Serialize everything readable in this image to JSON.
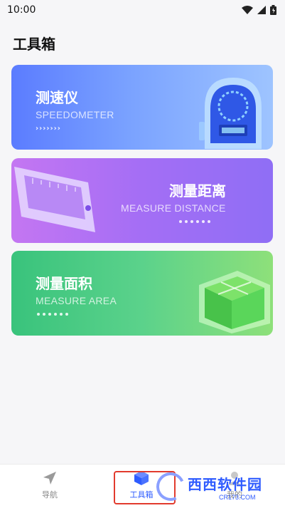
{
  "status": {
    "time": "10:00"
  },
  "page": {
    "title": "工具箱"
  },
  "cards": [
    {
      "title": "测速仪",
      "subtitle": "SPEEDOMETER"
    },
    {
      "title": "测量距离",
      "subtitle": "MEASURE DISTANCE"
    },
    {
      "title": "测量面积",
      "subtitle": "MEASURE AREA"
    }
  ],
  "nav": [
    {
      "label": "导航"
    },
    {
      "label": "工具箱"
    },
    {
      "label": "我的"
    }
  ],
  "watermark": {
    "main": "西西软件园",
    "small": "CR173.COM"
  },
  "colors": {
    "accent": "#2f5cff",
    "highlight": "#e23b2e"
  }
}
